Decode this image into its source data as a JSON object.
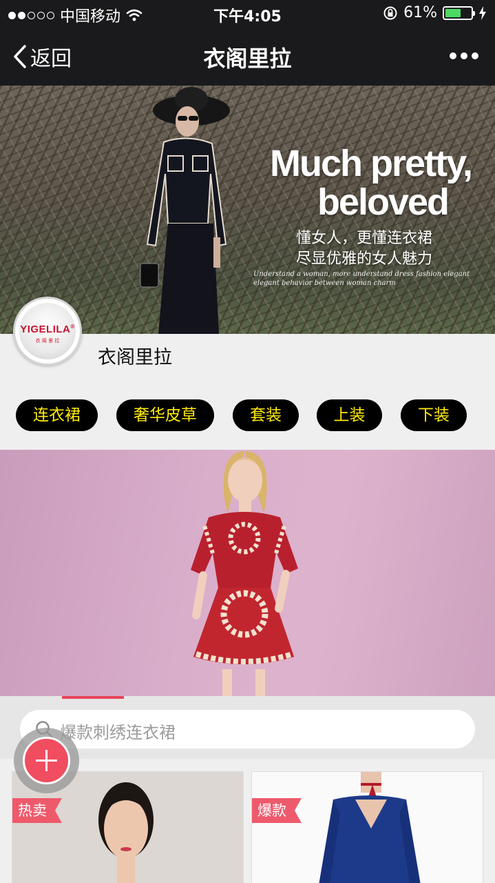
{
  "status_bar": {
    "carrier": "中国移动",
    "time": "下午4:05",
    "battery_percent": "61%",
    "battery_level": 0.61,
    "signal_bars": 2
  },
  "nav": {
    "back_label": "返回",
    "title": "衣阁里拉"
  },
  "banner": {
    "headline_line1": "Much pretty,",
    "headline_line2": "beloved",
    "subtitle_line1": "懂女人，更懂连衣裙",
    "subtitle_line2": "尽显优雅的女人魅力",
    "small_line1": "Understand a woman, more understand dress fashion elegant",
    "small_line2": "elegant behavior between woman charm"
  },
  "store": {
    "logo_text": "YIGELILA",
    "logo_registered": "®",
    "logo_subtext": "衣 阁 里 拉",
    "name": "衣阁里拉"
  },
  "categories": [
    "连衣裙",
    "奢华皮草",
    "套装",
    "上装",
    "下装"
  ],
  "search": {
    "placeholder": "爆款刺绣连衣裙"
  },
  "products": [
    {
      "badge": "热卖"
    },
    {
      "badge": "爆款"
    }
  ],
  "colors": {
    "nav_background": "#1a1a1c",
    "tag_background": "#000000",
    "tag_text": "#ffeb0a",
    "accent": "#ee5a6c",
    "battery_fill": "#4cd964"
  }
}
